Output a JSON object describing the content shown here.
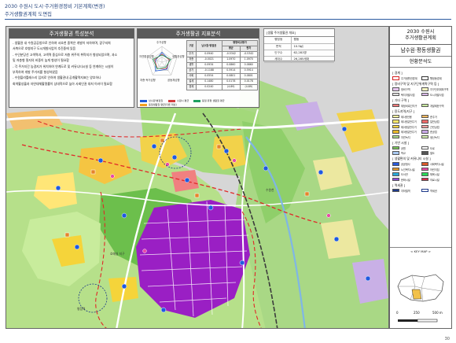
{
  "header": {
    "title": "2030 수원시 도시·주거환경정비 기본계획(변경)",
    "subtitle": "주거생활권계획 도면집"
  },
  "analysis": {
    "heading": "주거생활권 특성분석",
    "bullets": [
      "- 생활권 내 수원공공청으로 인하여 서호천 중북은 개발이 저하하며, 광구지희",
      "서측으로 호병지구 도시개발사업이 추진중에 있음",
      "- 수인분당선 고색역과, 고색역 중심으로 저층 위주의 취락지가 형성되었으며, 과소",
      "및 저층형 필지의 비중이 높게 형성이 필요함",
      "- 각 주거지간 농경지가 위치하여 연계도로 및 커뮤니티시설 등 연계하는 시설이",
      "부족하여 개발 주거지를 형성하였음",
      "- 수원플라틀레스리 입지로 인하여 생활권내 공개활력지표는 양호하나",
      "회색활성율과 자연대체활명률이 상대적으로 높아 사회인권 대처 이러이 필요함"
    ]
  },
  "indicators": {
    "heading": "주거생활권 지표분석",
    "radar_axes": [
      "주거성향",
      "생활권성향",
      "공동체성향",
      "저층·독거성향",
      "자연환경성향"
    ],
    "table_header": [
      "구분",
      "남수원·병점권",
      "평균",
      "편차"
    ],
    "table_header_group": "평형비교평가",
    "rows": [
      {
        "label": "주거",
        "a": "0.0940",
        "b": "-0.5342",
        "c": "-0.5342"
      },
      {
        "label": "저층",
        "a": "-0.0021",
        "b": "1.0970",
        "c": "1.0970"
      },
      {
        "label": "생활",
        "a": "0.0934",
        "b": "0.0860",
        "c": "0.0860"
      },
      {
        "label": "공가",
        "a": "-0.1188",
        "b": "0.5914",
        "c": "0.5914"
      },
      {
        "label": "사회",
        "a": "0.0554",
        "b": "0.0801",
        "c": "0.0801"
      },
      {
        "label": "설세",
        "a": "0.1480",
        "b": "0.0178",
        "c": "0.0178"
      },
      {
        "label": "경제",
        "a": "0.0240",
        "b": "(4.89)",
        "c": "(4.89)"
      }
    ],
    "legend": [
      "남수원·병점권",
      "수원시 평균",
      "동일 유형 생활권 평균",
      "동일생활권 평균(다른 대상)"
    ],
    "series": [
      {
        "name": "남수원·병점권",
        "values": [
          0.62,
          0.48,
          0.55,
          0.7,
          0.42
        ],
        "color": "#1e5bd8"
      },
      {
        "name": "수원시 평균",
        "values": [
          0.5,
          0.5,
          0.5,
          0.5,
          0.5
        ],
        "color": "#d43c3c"
      },
      {
        "name": "동일 유형 생활권 평균",
        "values": [
          0.45,
          0.58,
          0.4,
          0.52,
          0.6
        ],
        "color": "#1ea060"
      }
    ]
  },
  "overview": {
    "title": "[생활 주거생활권 개요]",
    "rows": [
      {
        "key": "행정동",
        "value": "평동"
      },
      {
        "key": "면적",
        "value": "10.5㎢"
      },
      {
        "key": "인구수",
        "value": "62,281명"
      },
      {
        "key": "세대수",
        "value": "26,285세대"
      }
    ]
  },
  "map_labels": {
    "south_area": "호매실 지구",
    "east_river": "수원천",
    "south_label": "병점역"
  },
  "side_panel": {
    "plan_title_line1": "2030 수원시",
    "plan_title_line2": "주거생활권계획",
    "zone_title": "남수원·평동생활권",
    "map_title": "현황분석도",
    "legend_groups": [
      {
        "title": "[ 경계 ]",
        "items": [
          {
            "label": "주거생활권경계",
            "color": "#ffffff",
            "border": "#d42020"
          },
          {
            "label": "행정동경계",
            "color": "#ffffff",
            "border": "#333333"
          }
        ]
      },
      {
        "title": "[ 정비구역 및 지구단위계획구역 등 ]",
        "items": [
          {
            "label": "정비구역",
            "color": "#e8c6f0"
          },
          {
            "label": "지구단위계획구역",
            "color": "#f4f4c0"
          },
          {
            "label": "택지개발사업",
            "color": "#e0e0e0"
          },
          {
            "label": "도시개발사업",
            "color": "#d9b8e8"
          }
        ]
      },
      {
        "title": "[ 기타 구역 ]",
        "items": [
          {
            "label": "재정비촉진지구",
            "color": "#f07a7a"
          },
          {
            "label": "개발제한구역",
            "color": "#c8e8a0"
          }
        ]
      },
      {
        "title": "[ 용도지역/지구 ]",
        "items": [
          {
            "label": "제1종전용",
            "color": "#fff8a0"
          },
          {
            "label": "준주거",
            "color": "#f4b860"
          },
          {
            "label": "제1종일반주거",
            "color": "#ffe86a"
          },
          {
            "label": "일반상업",
            "color": "#f06a6a"
          },
          {
            "label": "제2종일반주거",
            "color": "#f5d442"
          },
          {
            "label": "근린상업",
            "color": "#f0a0a0"
          },
          {
            "label": "제3종일반주거",
            "color": "#e8b82a"
          },
          {
            "label": "준공업",
            "color": "#c8a8e8"
          },
          {
            "label": "자연녹지",
            "color": "#a8d888"
          },
          {
            "label": "생산녹지",
            "color": "#d4f0b0"
          }
        ]
      },
      {
        "title": "[ 기반 시설 ]",
        "items": [
          {
            "label": "공원",
            "color": "#7ac85a"
          },
          {
            "label": "도로",
            "color": "#ffffff"
          },
          {
            "label": "학교",
            "color": "#a8c8f0"
          },
          {
            "label": "철도",
            "color": "#555555"
          }
        ]
      },
      {
        "title": "[ 생활편의 및 커뮤니티 시설 ]",
        "items": [
          {
            "label": "공공청사",
            "color": "#2a5ad8"
          },
          {
            "label": "사회복지시설",
            "color": "#d85a2a"
          },
          {
            "label": "노인복지시설",
            "color": "#e89a2a"
          },
          {
            "label": "어린이집",
            "color": "#e84aa8"
          },
          {
            "label": "도서관",
            "color": "#2aa8d8"
          },
          {
            "label": "체육시설",
            "color": "#2ad85a"
          },
          {
            "label": "문화시설",
            "color": "#8a4ad8"
          },
          {
            "label": "의료시설",
            "color": "#d82a4a"
          }
        ]
      },
      {
        "title": "[ 역세권 ]",
        "items": [
          {
            "label": "지하철역",
            "color": "#1e3a8a"
          },
          {
            "label": "역세권",
            "color": "#ffffff",
            "border": "#1e3a8a"
          }
        ]
      }
    ],
    "keymap_title": "< KEY MAP >",
    "scale_labels": [
      "0",
      "250",
      "500 m"
    ]
  },
  "page_number": "30"
}
